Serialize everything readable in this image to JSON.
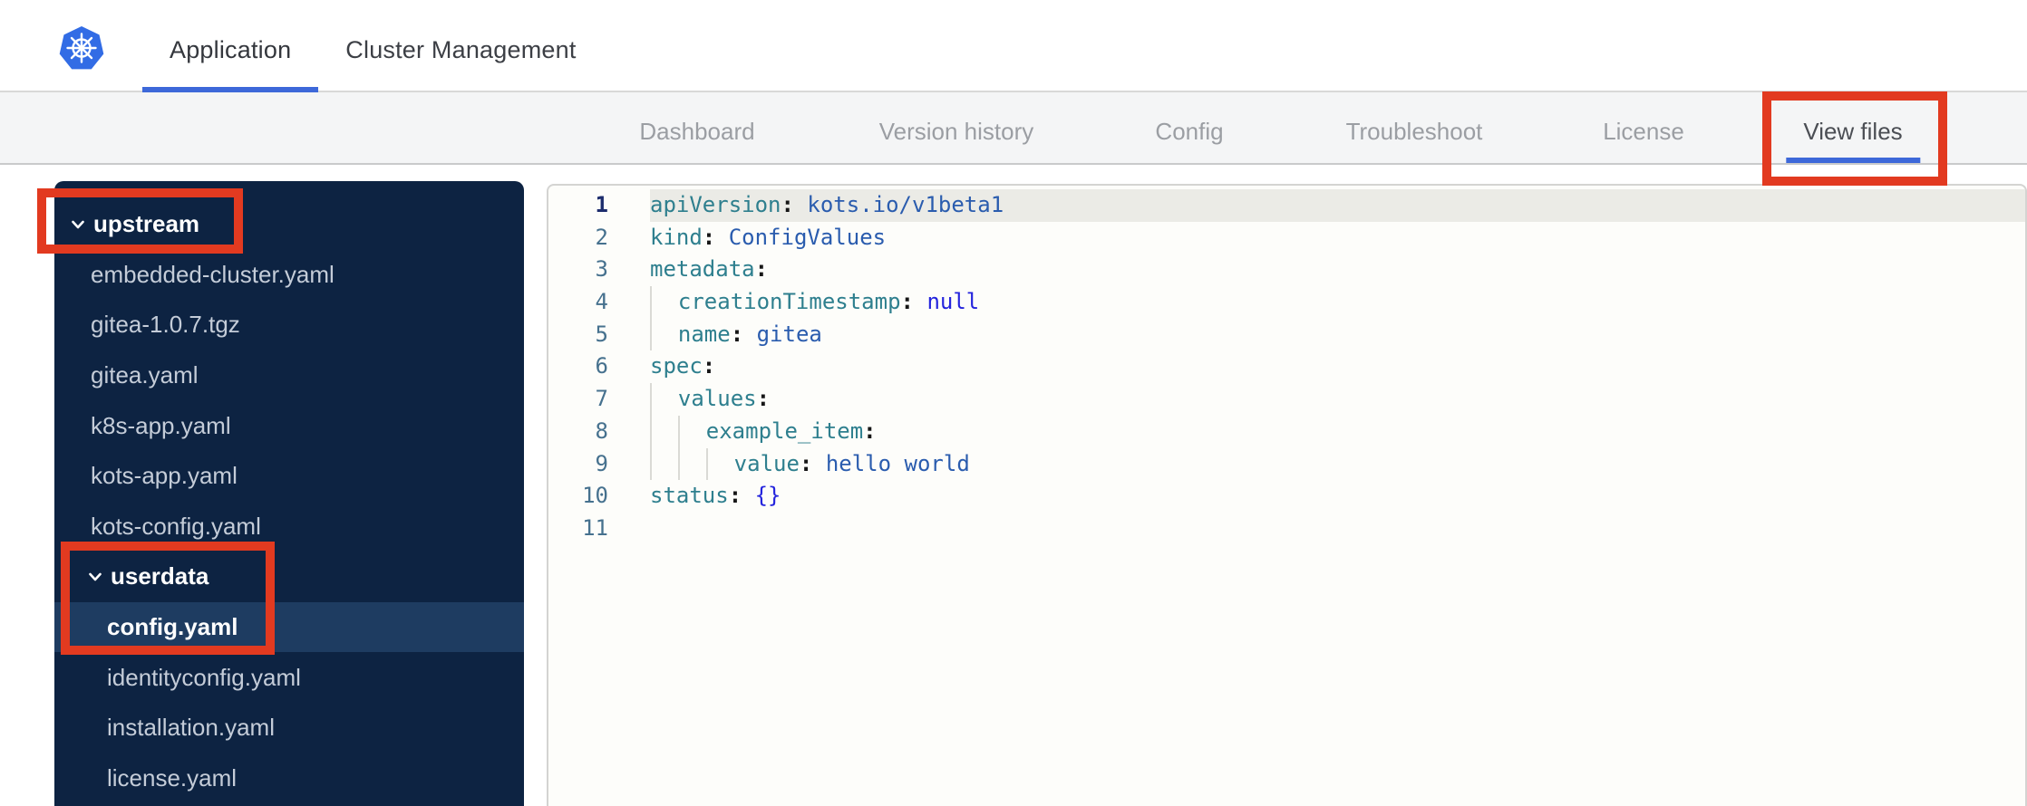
{
  "header": {
    "tabs": [
      {
        "label": "Application",
        "active": true
      },
      {
        "label": "Cluster Management",
        "active": false
      }
    ]
  },
  "nav": {
    "tabs": [
      {
        "label": "Dashboard",
        "active": false
      },
      {
        "label": "Version history",
        "active": false
      },
      {
        "label": "Config",
        "active": false
      },
      {
        "label": "Troubleshoot",
        "active": false
      },
      {
        "label": "License",
        "active": false
      },
      {
        "label": "View files",
        "active": true
      }
    ]
  },
  "file_tree": {
    "items": [
      {
        "label": "upstream",
        "type": "folder",
        "level": 0,
        "expanded": true
      },
      {
        "label": "embedded-cluster.yaml",
        "type": "file",
        "level": 1
      },
      {
        "label": "gitea-1.0.7.tgz",
        "type": "file",
        "level": 1
      },
      {
        "label": "gitea.yaml",
        "type": "file",
        "level": 1
      },
      {
        "label": "k8s-app.yaml",
        "type": "file",
        "level": 1
      },
      {
        "label": "kots-app.yaml",
        "type": "file",
        "level": 1
      },
      {
        "label": "kots-config.yaml",
        "type": "file",
        "level": 1
      },
      {
        "label": "userdata",
        "type": "folder",
        "level": 1,
        "expanded": true
      },
      {
        "label": "config.yaml",
        "type": "file",
        "level": 2,
        "selected": true
      },
      {
        "label": "identityconfig.yaml",
        "type": "file",
        "level": 2
      },
      {
        "label": "installation.yaml",
        "type": "file",
        "level": 2
      },
      {
        "label": "license.yaml",
        "type": "file",
        "level": 2
      }
    ]
  },
  "editor": {
    "lines": [
      {
        "num": 1,
        "indent": 0,
        "highlight": true,
        "active": true,
        "tokens": [
          {
            "t": "key",
            "v": "apiVersion"
          },
          {
            "t": "pun",
            "v": ": "
          },
          {
            "t": "str",
            "v": "kots.io/v1beta1"
          }
        ]
      },
      {
        "num": 2,
        "indent": 0,
        "tokens": [
          {
            "t": "key",
            "v": "kind"
          },
          {
            "t": "pun",
            "v": ": "
          },
          {
            "t": "str",
            "v": "ConfigValues"
          }
        ]
      },
      {
        "num": 3,
        "indent": 0,
        "tokens": [
          {
            "t": "key",
            "v": "metadata"
          },
          {
            "t": "pun",
            "v": ":"
          }
        ]
      },
      {
        "num": 4,
        "indent": 1,
        "tokens": [
          {
            "t": "key",
            "v": "creationTimestamp"
          },
          {
            "t": "pun",
            "v": ": "
          },
          {
            "t": "kw",
            "v": "null"
          }
        ]
      },
      {
        "num": 5,
        "indent": 1,
        "tokens": [
          {
            "t": "key",
            "v": "name"
          },
          {
            "t": "pun",
            "v": ": "
          },
          {
            "t": "str",
            "v": "gitea"
          }
        ]
      },
      {
        "num": 6,
        "indent": 0,
        "tokens": [
          {
            "t": "key",
            "v": "spec"
          },
          {
            "t": "pun",
            "v": ":"
          }
        ]
      },
      {
        "num": 7,
        "indent": 1,
        "tokens": [
          {
            "t": "key",
            "v": "values"
          },
          {
            "t": "pun",
            "v": ":"
          }
        ]
      },
      {
        "num": 8,
        "indent": 2,
        "tokens": [
          {
            "t": "key",
            "v": "example_item"
          },
          {
            "t": "pun",
            "v": ":"
          }
        ]
      },
      {
        "num": 9,
        "indent": 3,
        "tokens": [
          {
            "t": "key",
            "v": "value"
          },
          {
            "t": "pun",
            "v": ": "
          },
          {
            "t": "str",
            "v": "hello world"
          }
        ]
      },
      {
        "num": 10,
        "indent": 0,
        "tokens": [
          {
            "t": "key",
            "v": "status"
          },
          {
            "t": "pun",
            "v": ": "
          },
          {
            "t": "kw",
            "v": "{}"
          }
        ]
      },
      {
        "num": 11,
        "indent": 0,
        "tokens": []
      }
    ]
  },
  "annotations": {
    "color": "#e23a20",
    "highlighted_targets": [
      "upstream",
      "userdata / config.yaml",
      "View files"
    ]
  },
  "colors": {
    "accent_blue": "#3d68d9",
    "annotation_red": "#e23a20",
    "sidebar_bg": "#0d2342",
    "selected_row_bg": "#1e3c61",
    "yaml_key_teal": "#2e7f8e",
    "yaml_string_blue": "#2a5cae",
    "yaml_keyword_blue": "#2424dd",
    "kubernetes_blue": "#326ce5"
  },
  "icons": {
    "logo": "kubernetes-logo",
    "folder_toggle": "chevron-down-icon"
  }
}
